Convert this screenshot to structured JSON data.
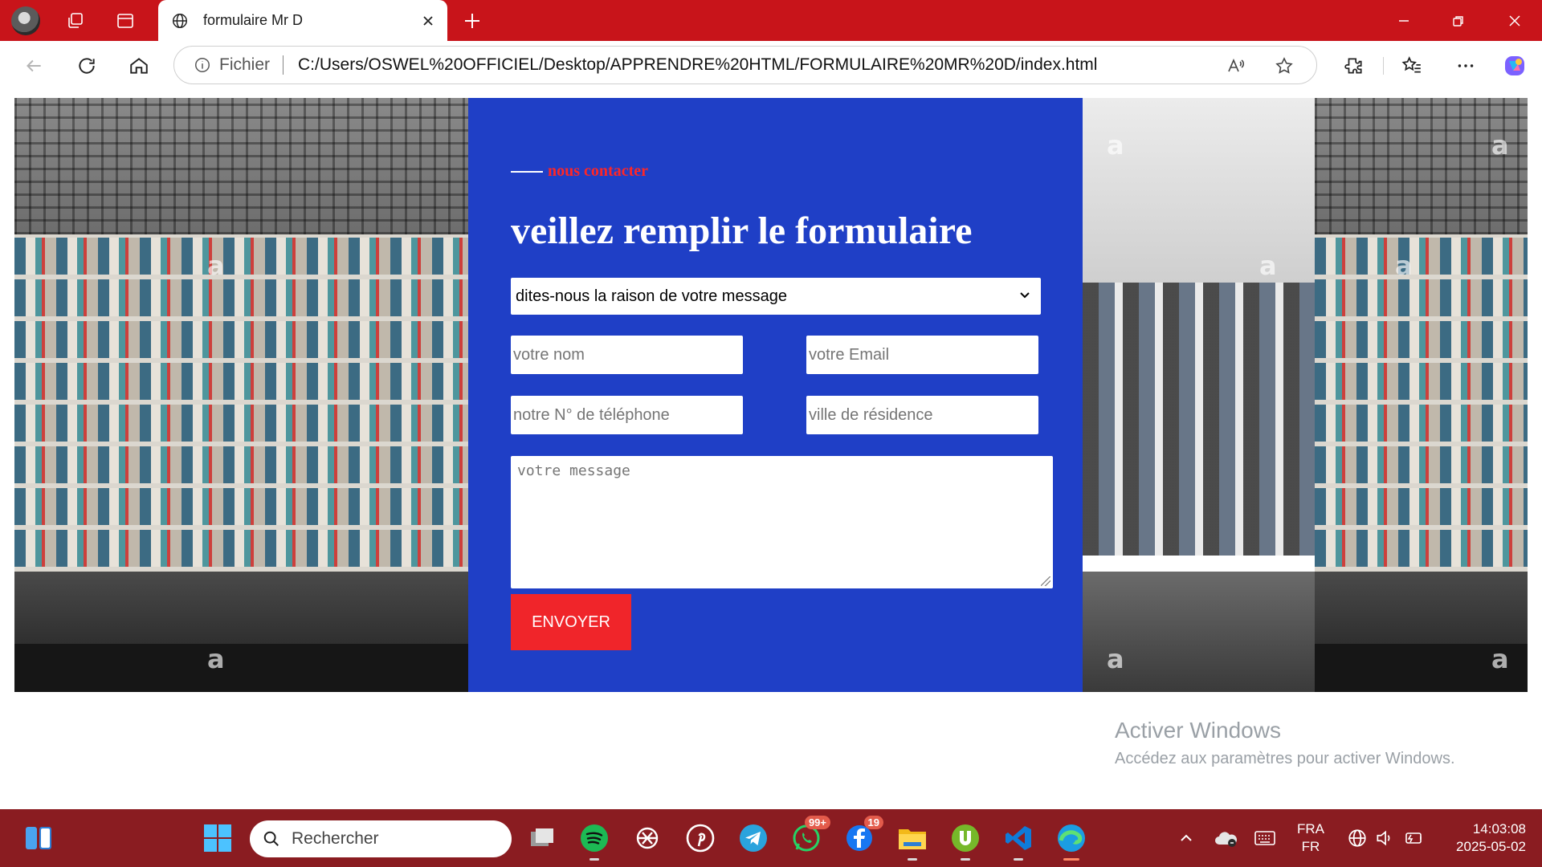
{
  "browser": {
    "tab_title": "formulaire Mr D",
    "scheme_label": "Fichier",
    "url": "C:/Users/OSWEL%20OFFICIEL/Desktop/APPRENDRE%20HTML/FORMULAIRE%20MR%20D/index.html"
  },
  "form": {
    "eyebrow": "nous contacter",
    "headline": "veillez remplir le formulaire",
    "reason_select": "dites-nous la raison de votre message",
    "name_placeholder": "votre nom",
    "email_placeholder": "votre Email",
    "phone_placeholder": "notre N° de téléphone",
    "city_placeholder": "ville de résidence",
    "message_placeholder": "votre message",
    "submit_label": "ENVOYER"
  },
  "watermarks": {
    "photo_text": "a"
  },
  "activation": {
    "title": "Activer Windows",
    "subtitle": "Accédez aux paramètres pour activer Windows."
  },
  "taskbar": {
    "search_label": "Rechercher",
    "whatsapp_badge": "99+",
    "messenger_badge": "19",
    "lang_top": "FRA",
    "lang_bottom": "FR",
    "time": "14:03:08",
    "date": "2025-05-02"
  },
  "colors": {
    "titlebar": "#c8141a",
    "form_panel": "#1f3fc6",
    "accent_red": "#f0252a",
    "taskbar": "#8a1c21"
  }
}
